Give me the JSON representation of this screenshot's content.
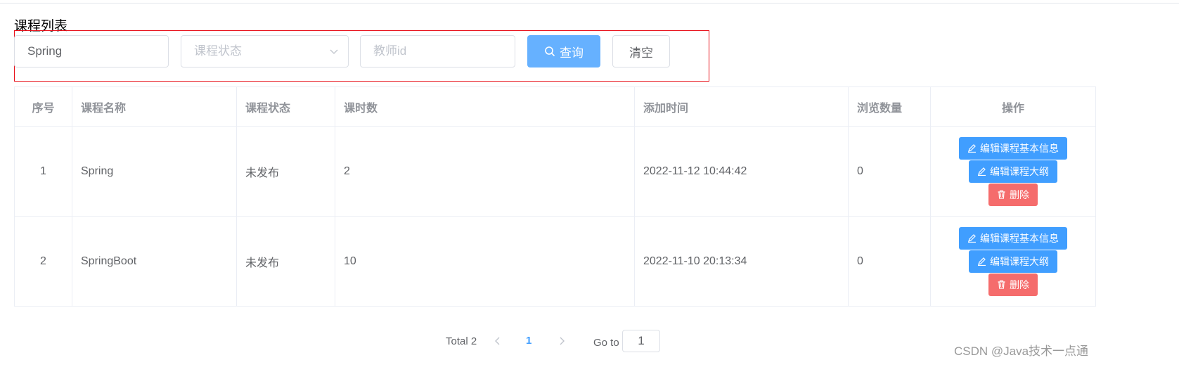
{
  "page": {
    "title": "课程列表"
  },
  "filters": {
    "name_value": "Spring",
    "status_placeholder": "课程状态",
    "teacher_placeholder": "教师id",
    "query_label": "查询",
    "clear_label": "清空"
  },
  "table": {
    "headers": [
      "序号",
      "课程名称",
      "课程状态",
      "课时数",
      "添加时间",
      "浏览数量",
      "操作"
    ],
    "rows": [
      {
        "index": "1",
        "name": "Spring",
        "status": "未发布",
        "hours": "2",
        "added": "2022-11-12 10:44:42",
        "views": "0"
      },
      {
        "index": "2",
        "name": "SpringBoot",
        "status": "未发布",
        "hours": "10",
        "added": "2022-11-10 20:13:34",
        "views": "0"
      }
    ],
    "actions": {
      "edit_basic": "编辑课程基本信息",
      "edit_outline": "编辑课程大纲",
      "delete": "删除"
    }
  },
  "pagination": {
    "total_label": "Total 2",
    "current_page": "1",
    "goto_label": "Go to",
    "goto_value": "1"
  },
  "watermark": "CSDN @Java技术一点通",
  "colors": {
    "primary": "#409eff",
    "primary_light": "#66b1ff",
    "danger": "#f56c6c",
    "filter_outline": "#e8101a"
  }
}
